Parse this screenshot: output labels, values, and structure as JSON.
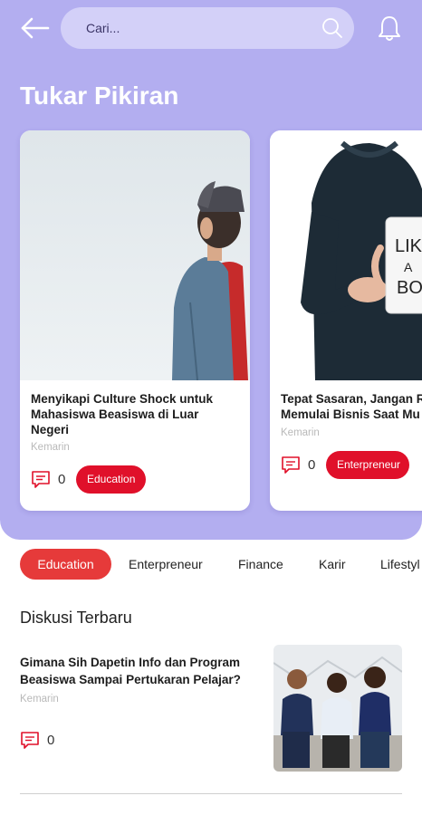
{
  "header": {
    "search_placeholder": "Cari...",
    "title": "Tukar Pikiran"
  },
  "featured": [
    {
      "title": "Menyikapi Culture Shock untuk Mahasiswa Beasiswa di Luar Negeri",
      "date": "Kemarin",
      "comments": "0",
      "tag": "Education"
    },
    {
      "title": "Tepat Sasaran, Jangan R\nMemulai Bisnis Saat Mu",
      "date": "Kemarin",
      "comments": "0",
      "tag": "Enterpreneur"
    }
  ],
  "tabs": [
    "Education",
    "Enterpreneur",
    "Finance",
    "Karir",
    "Lifestyl"
  ],
  "latest": {
    "heading": "Diskusi Terbaru",
    "posts": [
      {
        "title": "Gimana Sih Dapetin Info dan Program Beasiswa Sampai Pertukaran Pelajar?",
        "date": "Kemarin",
        "comments": "0"
      }
    ]
  },
  "colors": {
    "header_bg": "#b3aef0",
    "search_bg": "#d3d0f8",
    "tag_red": "#e0102a",
    "tab_active": "#e63a3a",
    "muted_text": "#b9b9b9"
  },
  "icons": {
    "back": "arrow-left-icon",
    "search": "search-icon",
    "notification": "bell-icon",
    "comment": "comment-icon"
  }
}
